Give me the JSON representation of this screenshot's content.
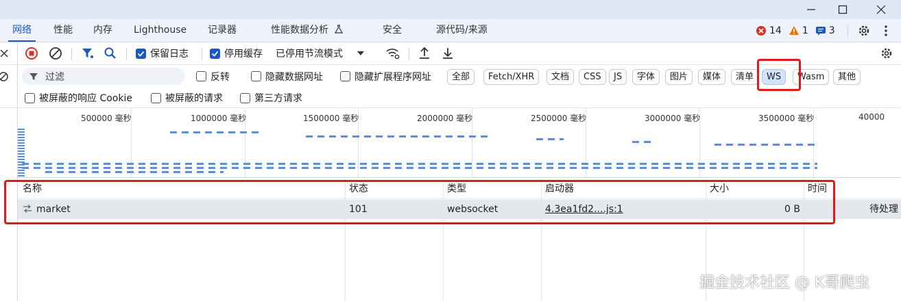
{
  "tabs": [
    {
      "label": "网络",
      "active": true
    },
    {
      "label": "性能"
    },
    {
      "label": "内存"
    },
    {
      "label": "Lighthouse"
    },
    {
      "label": "记录器"
    },
    {
      "label": "性能数据分析"
    },
    {
      "label": "安全"
    },
    {
      "label": "源代码/来源"
    }
  ],
  "counts": {
    "errors": "14",
    "warnings": "1",
    "messages": "3"
  },
  "toolbar": {
    "preserve_log": "保留日志",
    "disable_cache": "停用缓存",
    "throttle": "已停用节流模式"
  },
  "filter": {
    "placeholder": "过滤",
    "invert": "反转",
    "hide_data_urls": "隐藏数据网址",
    "hide_ext_urls": "隐藏扩展程序网址",
    "types": [
      "全部",
      "Fetch/XHR",
      "文档",
      "CSS",
      "JS",
      "字体",
      "图片",
      "媒体",
      "清单",
      "WS",
      "Wasm",
      "其他"
    ],
    "selected_type": "WS"
  },
  "row3": {
    "blocked_cookies": "被屏蔽的响应 Cookie",
    "blocked_requests": "被屏蔽的请求",
    "third_party": "第三方请求"
  },
  "overview": {
    "ticks": [
      "500000 毫秒",
      "1000000 毫秒",
      "1500000 毫秒",
      "2000000 毫秒",
      "2500000 毫秒",
      "3000000 毫秒",
      "3500000 毫秒",
      "40000"
    ]
  },
  "table": {
    "headers": [
      "名称",
      "状态",
      "类型",
      "启动器",
      "大小",
      "时间"
    ],
    "rows": [
      {
        "name": "market",
        "status": "101",
        "type": "websocket",
        "initiator": "4.3ea1fd2....js:1",
        "size": "0 B",
        "time": "待处理"
      }
    ]
  },
  "watermark": "掘金技术社区 @ K哥爬虫",
  "colors": {
    "accent": "#1a57c2",
    "highlight": "#e0191f",
    "error": "#d93025",
    "warning": "#e8710a"
  }
}
